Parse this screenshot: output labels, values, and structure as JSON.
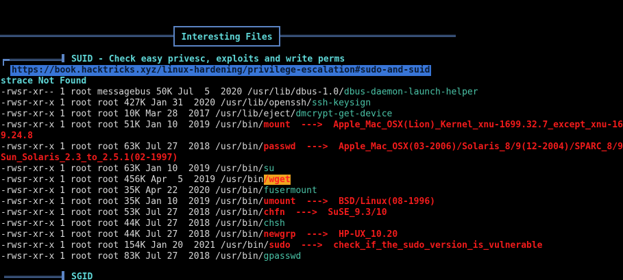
{
  "section": {
    "title": "Interesting Files"
  },
  "subsections": {
    "suid_title": "SUID - Check easy privesc, exploits and write perms",
    "suid_link": "https://book.hacktricks.xyz/linux-hardening/privilege-escalation#sudo-and-suid",
    "sgid_title": "SGID"
  },
  "lines": [
    {
      "segments": [
        {
          "cls": "cyan",
          "text": "strace Not Found"
        }
      ]
    },
    {
      "segments": [
        {
          "cls": "plain",
          "text": "-rwsr-xr-- 1 root messagebus 50K Jul  5  2020 /usr/lib/dbus-1.0/"
        },
        {
          "cls": "green",
          "text": "dbus-daemon-launch-helper"
        }
      ]
    },
    {
      "segments": [
        {
          "cls": "plain",
          "text": "-rwsr-xr-x 1 root root 427K Jan 31  2020 /usr/lib/openssh/"
        },
        {
          "cls": "green",
          "text": "ssh-keysign"
        }
      ]
    },
    {
      "segments": [
        {
          "cls": "plain",
          "text": "-rwsr-xr-x 1 root root 10K Mar 28  2017 /usr/lib/eject/"
        },
        {
          "cls": "green",
          "text": "dmcrypt-get-device"
        }
      ]
    },
    {
      "segments": [
        {
          "cls": "plain",
          "text": "-rwsr-xr-x 1 root root 51K Jan 10  2019 /usr/bin/"
        },
        {
          "cls": "red",
          "text": "mount  --->  Apple_Mac_OSX(Lion)_Kernel_xnu-1699.32.7_except_xnu-1699."
        }
      ]
    },
    {
      "segments": [
        {
          "cls": "red",
          "text": "9.24.8"
        }
      ]
    },
    {
      "segments": [
        {
          "cls": "plain",
          "text": "-rwsr-xr-x 1 root root 63K Jul 27  2018 /usr/bin/"
        },
        {
          "cls": "red",
          "text": "passwd  --->  Apple_Mac_OSX(03-2006)/Solaris_8/9(12-2004)/SPARC_8/9/"
        }
      ]
    },
    {
      "segments": [
        {
          "cls": "red",
          "text": "Sun_Solaris_2.3_to_2.5.1(02-1997)"
        }
      ]
    },
    {
      "segments": [
        {
          "cls": "plain",
          "text": "-rwsr-xr-x 1 root root 63K Jan 10  2019 /usr/bin/"
        },
        {
          "cls": "green",
          "text": "su"
        }
      ]
    },
    {
      "segments": [
        {
          "cls": "plain",
          "text": "-rwsr-xr-x 1 root root 456K Apr  5  2019 /usr/bin"
        },
        {
          "cls": "hl",
          "text": "/wget"
        }
      ]
    },
    {
      "segments": [
        {
          "cls": "plain",
          "text": "-rwsr-xr-x 1 root root 35K Apr 22  2020 /usr/bin/"
        },
        {
          "cls": "green",
          "text": "fusermount"
        }
      ]
    },
    {
      "segments": [
        {
          "cls": "plain",
          "text": "-rwsr-xr-x 1 root root 35K Jan 10  2019 /usr/bin/"
        },
        {
          "cls": "red",
          "text": "umount  --->  BSD/Linux(08-1996)"
        }
      ]
    },
    {
      "segments": [
        {
          "cls": "plain",
          "text": "-rwsr-xr-x 1 root root 53K Jul 27  2018 /usr/bin/"
        },
        {
          "cls": "red",
          "text": "chfn  --->  SuSE_9.3/10"
        }
      ]
    },
    {
      "segments": [
        {
          "cls": "plain",
          "text": "-rwsr-xr-x 1 root root 44K Jul 27  2018 /usr/bin/"
        },
        {
          "cls": "green",
          "text": "chsh"
        }
      ]
    },
    {
      "segments": [
        {
          "cls": "plain",
          "text": "-rwsr-xr-x 1 root root 44K Jul 27  2018 /usr/bin/"
        },
        {
          "cls": "red",
          "text": "newgrp  --->  HP-UX_10.20"
        }
      ]
    },
    {
      "segments": [
        {
          "cls": "plain",
          "text": "-rwsr-xr-x 1 root root 154K Jan 20  2021 /usr/bin/"
        },
        {
          "cls": "red",
          "text": "sudo  --->  check_if_the_sudo_version_is_vulnerable"
        }
      ]
    },
    {
      "segments": [
        {
          "cls": "plain",
          "text": "-rwsr-xr-x 1 root root 83K Jul 27  2018 /usr/bin/"
        },
        {
          "cls": "green",
          "text": "gpasswd"
        }
      ]
    }
  ]
}
